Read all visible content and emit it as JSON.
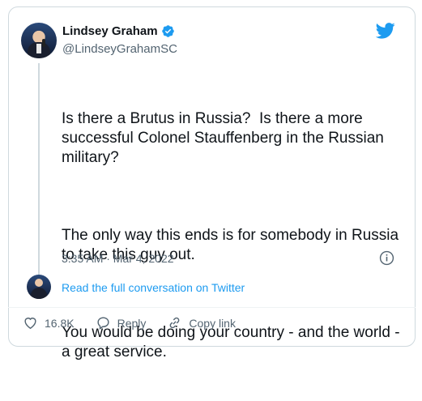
{
  "author": {
    "name": "Lindsey Graham",
    "handle": "@LindseyGrahamSC"
  },
  "tweet": {
    "paragraphs": [
      "Is there a Brutus in Russia?  Is there a more successful Colonel Stauffenberg in the Russian military?",
      "The only way this ends is for somebody in Russia to take this guy out.",
      "You would be doing your country - and the world - a great service."
    ],
    "timestamp": "3:35 AM · Mar 4, 2022"
  },
  "thread": {
    "read_full_label": "Read the full conversation on Twitter"
  },
  "actions": {
    "likes": "16.8K",
    "reply_label": "Reply",
    "copy_link_label": "Copy link"
  },
  "colors": {
    "accent": "#1d9bf0",
    "like": "#536471",
    "text": "#0f1419",
    "muted": "#536471"
  }
}
